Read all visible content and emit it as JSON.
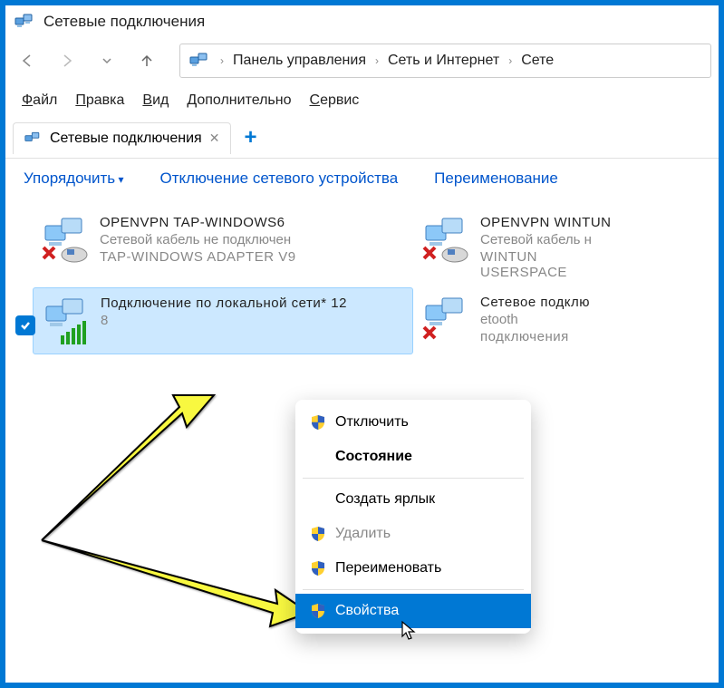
{
  "window": {
    "title": "Сетевые подключения"
  },
  "breadcrumb": {
    "items": [
      "Панель управления",
      "Сеть и Интернет",
      "Сете"
    ]
  },
  "menubar": {
    "file": "Файл",
    "edit": "Правка",
    "view": "Вид",
    "extra": "Дополнительно",
    "service": "Сервис"
  },
  "tab": {
    "label": "Сетевые подключения"
  },
  "toolbar": {
    "arrange": "Упорядочить",
    "disable": "Отключение сетевого устройства",
    "rename": "Переименование"
  },
  "connections": [
    {
      "name": "OPENVPN TAP-WINDOWS6",
      "status": "Сетевой кабель не подключен",
      "adapter": "TAP-WINDOWS ADAPTER V9"
    },
    {
      "name": "OPENVPN WINTUN",
      "status": "Сетевой кабель н",
      "adapter": "WINTUN USERSPACE"
    },
    {
      "name": "Подключение по локальной сети* 12",
      "status": "",
      "adapter": "8"
    },
    {
      "name": "Сетевое подклю",
      "status": "etooth",
      "adapter": "подключения"
    }
  ],
  "context_menu": {
    "disable": "Отключить",
    "status": "Состояние",
    "shortcut": "Создать ярлык",
    "delete": "Удалить",
    "rename": "Переименовать",
    "properties": "Свойства"
  }
}
